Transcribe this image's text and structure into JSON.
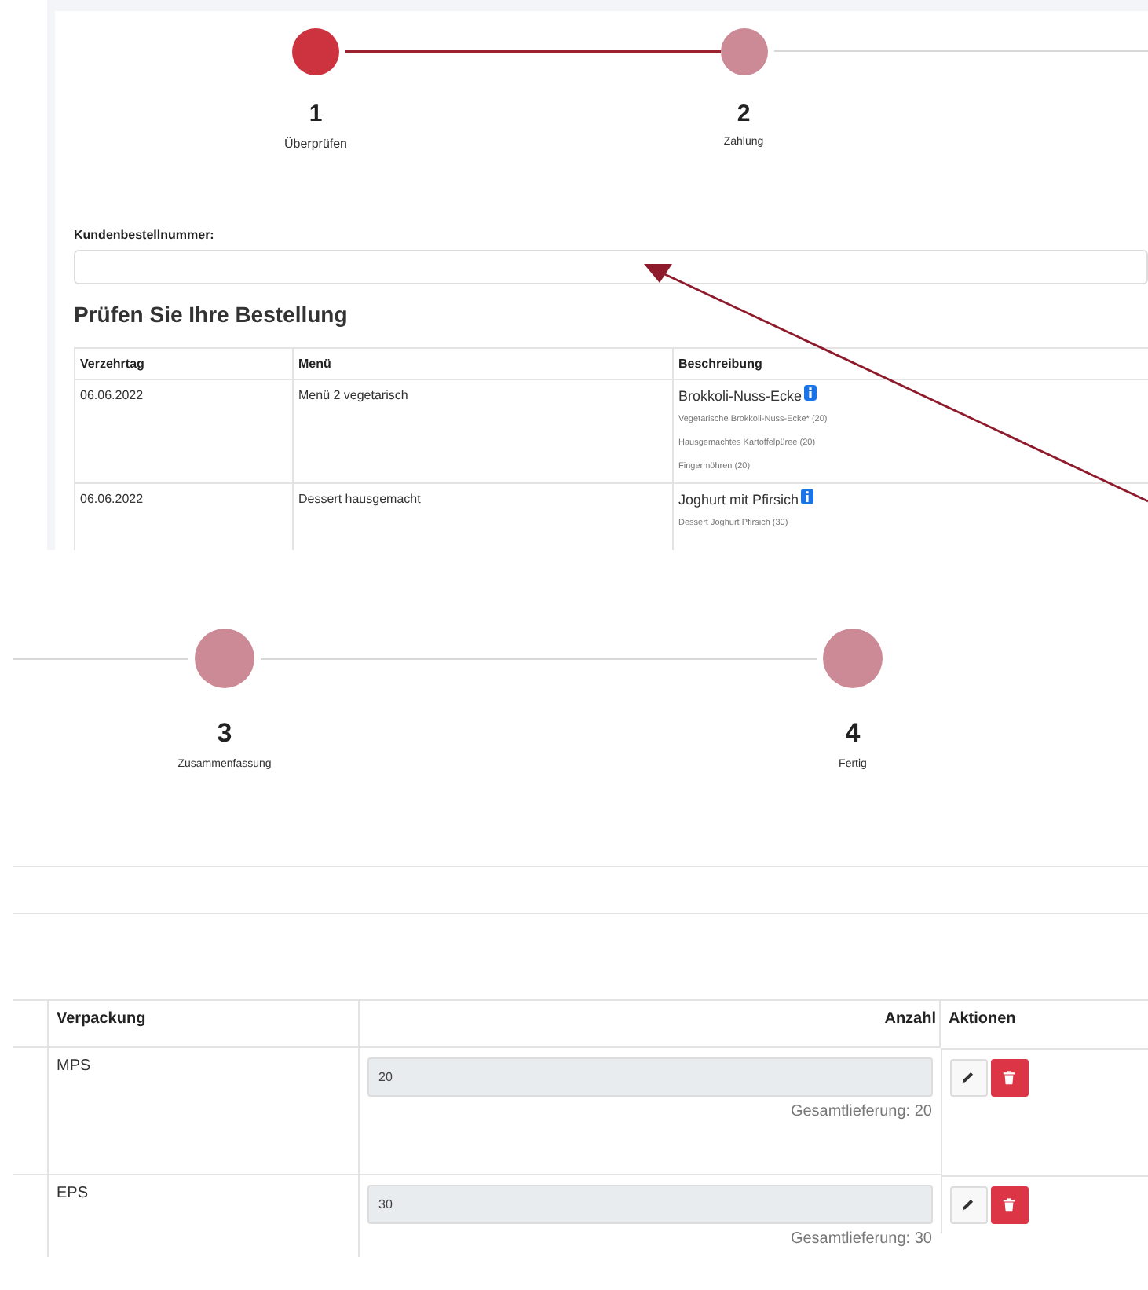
{
  "order_panel": {
    "steps": [
      {
        "number": "1",
        "label": "Überprüfen",
        "active": true
      },
      {
        "number": "2",
        "label": "Zahlung",
        "active": false
      }
    ],
    "order_number": {
      "label": "Kundenbestellnummer:"
    },
    "heading": "Prüfen Sie Ihre Bestellung",
    "table": {
      "columns": [
        "Verzehrtag",
        "Menü",
        "Beschreibung"
      ],
      "rows": [
        {
          "date": "06.06.2022",
          "menu": "Menü 2 vegetarisch",
          "description": {
            "name": "Brokkoli-Nuss-Ecke",
            "items": [
              "Vegetarische Brokkoli-Nuss-Ecke* (20)",
              "Hausgemachtes Kartoffelpüree (20)",
              "Fingermöhren (20)"
            ]
          }
        },
        {
          "date": "06.06.2022",
          "menu": "Dessert hausgemacht",
          "description": {
            "name": "Joghurt mit Pfirsich",
            "items": [
              "Dessert Joghurt Pfirsich (30)"
            ]
          }
        }
      ]
    }
  },
  "detail_panel": {
    "steps": [
      {
        "number": "3",
        "label": "Zusammenfassung",
        "active": false
      },
      {
        "number": "4",
        "label": "Fertig",
        "active": false
      }
    ],
    "table": {
      "columns": [
        "Verpackung",
        "Anzahl",
        "Aktionen"
      ],
      "rows": [
        {
          "packaging": "MPS",
          "quantity": "20",
          "disabled": true,
          "total": "Gesamtlieferung: 20"
        },
        {
          "packaging": "EPS",
          "quantity": "30",
          "disabled": true,
          "total": "Gesamtlieferung: 30"
        }
      ]
    }
  }
}
